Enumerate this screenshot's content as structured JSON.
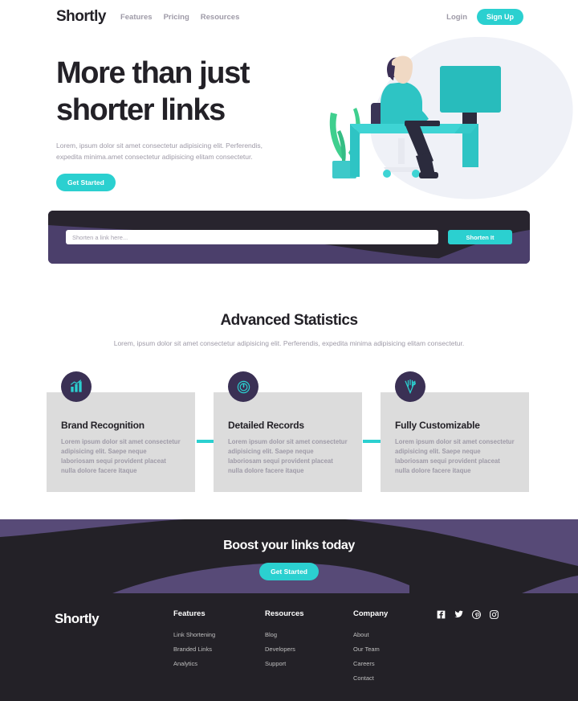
{
  "brand": {
    "name": "Shortly"
  },
  "nav": {
    "links": [
      {
        "label": "Features",
        "name": "nav-link-features"
      },
      {
        "label": "Pricing",
        "name": "nav-link-pricing"
      },
      {
        "label": "Resources",
        "name": "nav-link-resources"
      }
    ],
    "login_label": "Login",
    "signup_label": "Sign Up"
  },
  "hero": {
    "title_line1": "More than just",
    "title_line2": "shorter links",
    "description": "Lorem, ipsum dolor sit amet consectetur adipisicing elit. Perferendis, expedita minima.amet consectetur adipisicing elitam consectetur.",
    "cta_label": "Get Started",
    "illustration": "person-at-desk-illustration"
  },
  "shorten": {
    "placeholder": "Shorten a link here...",
    "value": "",
    "button_label": "Shorten It"
  },
  "stats": {
    "title": "Advanced Statistics",
    "description": "Lorem, ipsum dolor sit amet consectetur adipisicing elit. Perferendis, expedita minima adipisicing elitam consectetur."
  },
  "cards": [
    {
      "title": "Brand Recognition",
      "body": "Lorem ipsum dolor sit amet consectetur adipisicing elit. Saepe neque laboriosam sequi provident placeat nulla dolore facere itaque",
      "icon": "brand-recognition-icon"
    },
    {
      "title": "Detailed Records",
      "body": "Lorem ipsum dolor sit amet consectetur adipisicing elit. Saepe neque laboriosam sequi provident placeat nulla dolore facere itaque",
      "icon": "detailed-records-gauge-icon"
    },
    {
      "title": "Fully Customizable",
      "body": "Lorem ipsum dolor sit amet consectetur adipisicing elit. Saepe neque laboriosam sequi provident placeat nulla dolore facere itaque",
      "icon": "fully-customizable-icon"
    }
  ],
  "boost": {
    "title": "Boost your links today",
    "cta_label": "Get Started"
  },
  "footer": {
    "brand": "Shortly",
    "columns": [
      {
        "title": "Features",
        "links": [
          {
            "label": "Link Shortening"
          },
          {
            "label": "Branded Links"
          },
          {
            "label": "Analytics"
          }
        ]
      },
      {
        "title": "Resources",
        "links": [
          {
            "label": "Blog"
          },
          {
            "label": "Developers"
          },
          {
            "label": "Support"
          }
        ]
      },
      {
        "title": "Company",
        "links": [
          {
            "label": "About"
          },
          {
            "label": "Our Team"
          },
          {
            "label": "Careers"
          },
          {
            "label": "Contact"
          }
        ]
      }
    ],
    "socials": [
      {
        "name": "facebook-icon"
      },
      {
        "name": "twitter-icon"
      },
      {
        "name": "pinterest-icon"
      },
      {
        "name": "instagram-icon"
      }
    ]
  },
  "colors": {
    "cyan": "#2bd0d0",
    "dark_violet": "#3a3054",
    "violet": "#4b3f6b",
    "near_black": "#232127",
    "gray_text": "#9e9aa7",
    "card_bg": "#dcdcdc"
  }
}
